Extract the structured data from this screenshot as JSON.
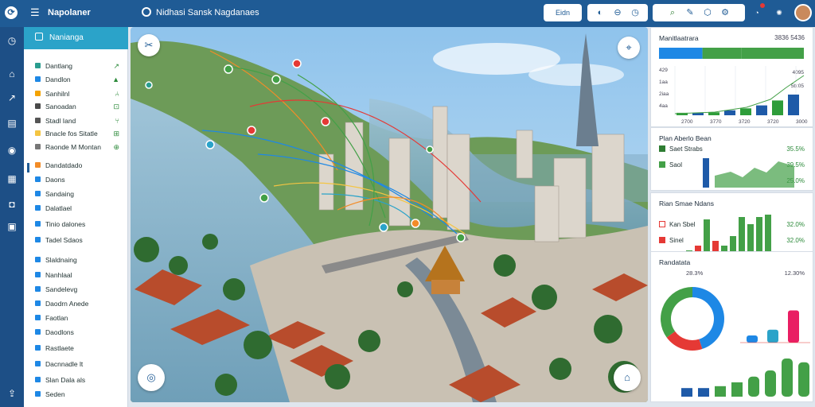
{
  "app": {
    "title": "Napolaner",
    "page_title": "Nidhasi Sansk Nagdanaes"
  },
  "toolbar": {
    "btn1_label": "Eidn",
    "btn2_label": "",
    "notifications_count": ""
  },
  "rail": {
    "icons": [
      "gauge-icon",
      "home-icon",
      "arrow-icon",
      "book-icon",
      "pin-icon",
      "building-icon",
      "camera-icon",
      "calendar-icon",
      "export-icon"
    ]
  },
  "sidebar": {
    "header": "Nanianga",
    "items": [
      {
        "label": "Dantlang",
        "color": "#2a9d8f",
        "tail": "↗"
      },
      {
        "label": "Dandlon",
        "color": "#1e88e5",
        "tail": "▲"
      },
      {
        "label": "Sanhilnl",
        "color": "#f4a300",
        "tail": "⑃"
      },
      {
        "label": "Sanoadan",
        "color": "#4a4a4a",
        "tail": "⊡"
      },
      {
        "label": "Stadl Iand",
        "color": "#555",
        "tail": "⑂"
      },
      {
        "label": "Bnacle fos Sitatle",
        "color": "#f4c542",
        "tail": "⊞"
      },
      {
        "label": "Raonde M Montan",
        "color": "#777",
        "tail": "⊕"
      },
      {
        "label": "Dandatdado",
        "color": "#f28c28",
        "tail": ""
      },
      {
        "label": "Daons",
        "color": "#1e88e5",
        "tail": ""
      },
      {
        "label": "Sandaing",
        "color": "#1e88e5",
        "tail": ""
      },
      {
        "label": "Dalatlael",
        "color": "#1e88e5",
        "tail": ""
      },
      {
        "label": "Tinio dalones",
        "color": "#1e88e5",
        "tail": ""
      },
      {
        "label": "Tadel Sdaos",
        "color": "#1e88e5",
        "tail": ""
      },
      {
        "label": "Slaldnaing",
        "color": "#1e88e5",
        "tail": ""
      },
      {
        "label": "Nanhlaal",
        "color": "#1e88e5",
        "tail": ""
      },
      {
        "label": "Sandelevg",
        "color": "#1e88e5",
        "tail": ""
      },
      {
        "label": "Daodrn Anede",
        "color": "#1e88e5",
        "tail": ""
      },
      {
        "label": "Faotlan",
        "color": "#1e88e5",
        "tail": ""
      },
      {
        "label": "Daodlons",
        "color": "#1e88e5",
        "tail": ""
      },
      {
        "label": "Rastlaete",
        "color": "#1e88e5",
        "tail": ""
      },
      {
        "label": "Dacnnadle lt",
        "color": "#1e88e5",
        "tail": ""
      },
      {
        "label": "Slan Dala als",
        "color": "#1e88e5",
        "tail": ""
      },
      {
        "label": "Seden",
        "color": "#1e88e5",
        "tail": ""
      }
    ]
  },
  "cards": {
    "c1": {
      "title": "Manitlaatrara",
      "value": "3836  5436",
      "yticks": [
        "429",
        "1aa",
        "2iaa",
        "4aa"
      ],
      "yvals": [
        "4095",
        "5b:05"
      ],
      "xticks": [
        "2700",
        "3770",
        "3720",
        "3720",
        "3000"
      ],
      "stack": [
        0.3,
        0.27,
        0.43
      ],
      "bars": [
        0.05,
        0.05,
        0.06,
        0.1,
        0.14,
        0.2,
        0.3,
        0.42
      ]
    },
    "c2": {
      "title": "Plan Aberlo Bean",
      "legend": [
        {
          "label": "Saet Strabs",
          "color": "#2e7d32",
          "value": "35.5%"
        },
        {
          "label": "Saol",
          "color": "#43a047",
          "value": "39.5%"
        },
        {
          "label": "",
          "color": "",
          "value": "25.0%"
        }
      ]
    },
    "c3": {
      "title": "Rian Smae Ndans",
      "legend": [
        {
          "label": "Kan Sbel",
          "color": "#e53935",
          "value": "32.0%"
        },
        {
          "label": "Sinel",
          "color": "#e53935",
          "value": "32.0%"
        }
      ],
      "bars": [
        0.2,
        0.3,
        0.85,
        0.4,
        0.3,
        0.5,
        0.9,
        0.75,
        0.9,
        0.95
      ]
    },
    "c4": {
      "title": "Randatata",
      "left_val": "28.3%",
      "right_val": "12.30%",
      "donut": [
        {
          "color": "#1e88e5",
          "value": 0.45
        },
        {
          "color": "#e53935",
          "value": 0.2
        },
        {
          "color": "#43a047",
          "value": 0.35
        }
      ],
      "right_bars": [
        0.1,
        0.18,
        0.45
      ],
      "bottom_bars": [
        0.18,
        0.18,
        0.22,
        0.3,
        0.42,
        0.55,
        0.8,
        0.72
      ]
    }
  }
}
